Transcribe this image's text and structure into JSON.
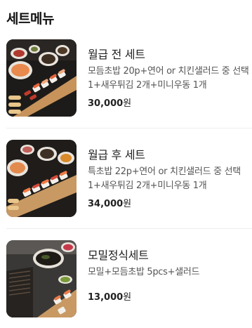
{
  "section": {
    "title": "세트메뉴"
  },
  "items": [
    {
      "name": "월급 전 세트",
      "description": "모듬초밥 20p+연어 or 치킨샐러드 중 선택1+새우튀김 2개+미니우동 1개",
      "price": "30,000",
      "currency": "원",
      "image": "sushi-set-platter-image"
    },
    {
      "name": "월급 후 세트",
      "description": "특초밥 22p+연어 or 치킨샐러드 중 선택1+새우튀김 2개+미니우동 1개",
      "price": "34,000",
      "currency": "원",
      "image": "premium-sushi-set-image"
    },
    {
      "name": "모밀정식세트",
      "description": "모밀+모듬초밥 5pcs+샐러드",
      "price": "13,000",
      "currency": "원",
      "image": "soba-set-image"
    }
  ]
}
